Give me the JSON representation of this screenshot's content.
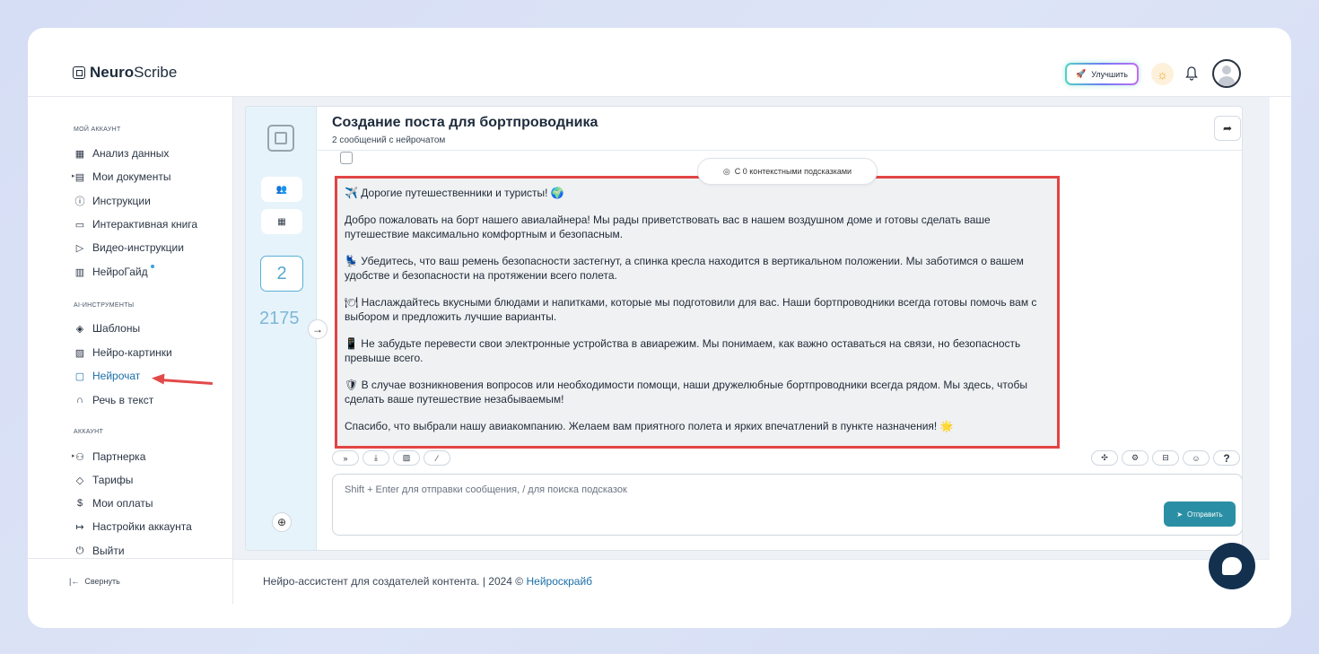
{
  "app": {
    "logo_bold": "Neuro",
    "logo_rest": "Scribe"
  },
  "header": {
    "upgrade_label": "Улучшить"
  },
  "sidebar": {
    "sections": [
      {
        "title": "МОЙ АККАУНТ"
      },
      {
        "title": "AI-ИНСТРУМЕНТЫ"
      },
      {
        "title": "АККАУНТ"
      }
    ],
    "items": [
      {
        "label": "Анализ данных",
        "icon": "grid-icon"
      },
      {
        "label": "Мои документы",
        "icon": "document-icon"
      },
      {
        "label": "Инструкции",
        "icon": "help-circle-icon"
      },
      {
        "label": "Интерактивная книга",
        "icon": "book-icon"
      },
      {
        "label": "Видео-инструкции",
        "icon": "video-icon"
      },
      {
        "label": "НейроГайд",
        "icon": "map-icon"
      },
      {
        "label": "Шаблоны",
        "icon": "layers-icon"
      },
      {
        "label": "Нейро-картинки",
        "icon": "image-icon"
      },
      {
        "label": "Нейрочат",
        "icon": "chat-icon"
      },
      {
        "label": "Речь в текст",
        "icon": "headphones-icon"
      },
      {
        "label": "Партнерка",
        "icon": "users-icon"
      },
      {
        "label": "Тарифы",
        "icon": "tag-icon"
      },
      {
        "label": "Мои оплаты",
        "icon": "dollar-icon"
      },
      {
        "label": "Настройки аккаунта",
        "icon": "login-icon"
      },
      {
        "label": "Выйти",
        "icon": "power-icon"
      }
    ],
    "collapse_label": "Свернуть"
  },
  "chat": {
    "message_count": "2",
    "token_count": "2175",
    "title": "Создание поста для бортпроводника",
    "subtitle": "2 сообщений с нейрочатом",
    "context_hint": "С 0 контекстными подсказками",
    "messages": [
      "✈️ Дорогие путешественники и туристы! 🌍",
      "Добро пожаловать на борт нашего авиалайнера! Мы рады приветствовать вас в нашем воздушном доме и готовы сделать ваше путешествие максимально комфортным и безопасным.",
      "💺 Убедитесь, что ваш ремень безопасности застегнут, а спинка кресла находится в вертикальном положении. Мы заботимся о вашем удобстве и безопасности на протяжении всего полета.",
      "🍽 Наслаждайтесь вкусными блюдами и напитками, которые мы подготовили для вас. Наши бортпроводники всегда готовы помочь вам с выбором и предложить лучшие варианты.",
      "📱 Не забудьте перевести свои электронные устройства в авиарежим. Мы понимаем, как важно оставаться на связи, но безопасность превыше всего.",
      "🛡 В случае возникновения вопросов или необходимости помощи, наши дружелюбные бортпроводники всегда рядом. Мы здесь, чтобы сделать ваше путешествие незабываемым!",
      "Спасибо, что выбрали нашу авиакомпанию. Желаем вам приятного полета и ярких впечатлений в пункте назначения! 🌟"
    ],
    "input_placeholder": "Shift + Enter для отправки сообщения, / для поиска подсказок",
    "send_label": "Отправить",
    "help_label": "?"
  },
  "footer": {
    "text": "Нейро-ассистент для создателей контента.  | 2024 © ",
    "link": "Нейроскрайб"
  },
  "colors": {
    "accent": "#1b6fa8",
    "send": "#2a8fa4",
    "highlight": "#e24444"
  }
}
